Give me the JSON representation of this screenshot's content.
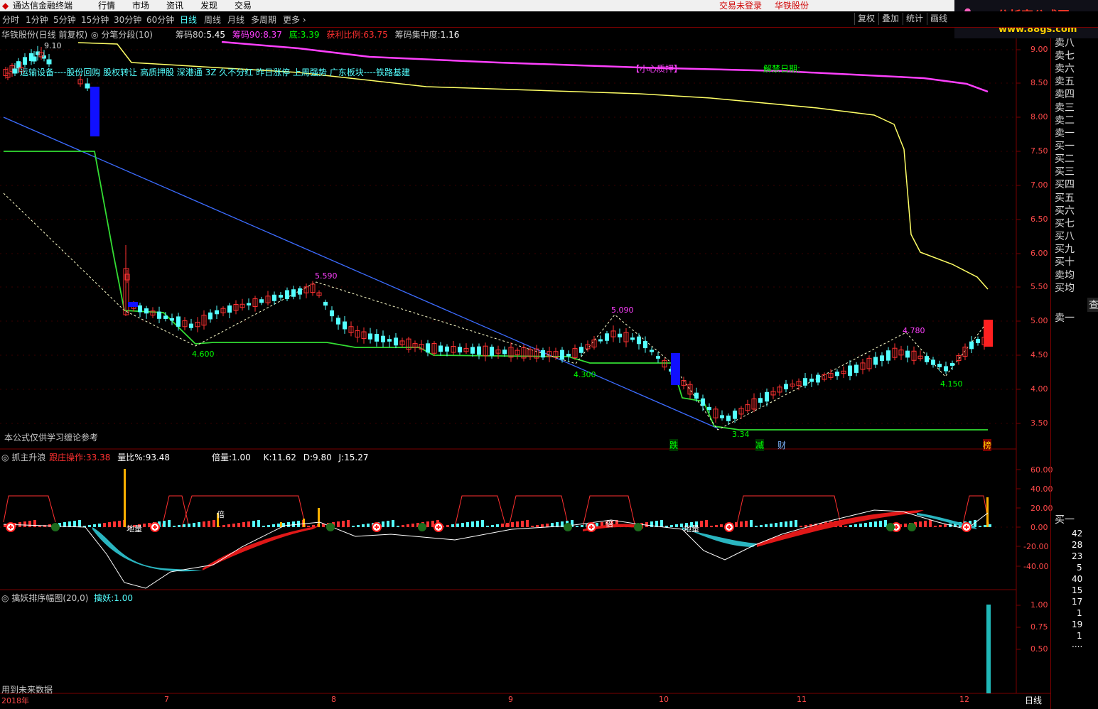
{
  "menubar": {
    "app_title": "通达信金融终端",
    "menus": [
      "行情",
      "市场",
      "资讯",
      "发现",
      "交易"
    ],
    "login_status": "交易未登录",
    "stock_name": "华铁股份",
    "logo_text": "分析家公式网",
    "logo_url": "www.88gs.com"
  },
  "tabs": [
    "分时",
    "1分钟",
    "5分钟",
    "15分钟",
    "30分钟",
    "60分钟",
    "日线",
    "周线",
    "月线",
    "多周期",
    "更多 ›"
  ],
  "active_tab": "日线",
  "right_buttons": [
    "复权",
    "叠加",
    "统计",
    "画线"
  ],
  "main_panel": {
    "title": "华铁股份(日线 前复权)",
    "indicator": "分笔分段(10)",
    "stats": [
      {
        "label": "筹码80:",
        "value": "5.45",
        "color": "#ffffff"
      },
      {
        "label": "筹码90:",
        "value": "8.37",
        "color": "#ff40ff"
      },
      {
        "label": "底:",
        "value": "3.39",
        "color": "#00ff00"
      },
      {
        "label": "获利比例:",
        "value": "63.75",
        "color": "#ff3030"
      },
      {
        "label": "筹码集中度:",
        "value": "1.16",
        "color": "#ffffff"
      }
    ],
    "concepts_line": "运输设备----股份回购 股权转让 高质押股 深港通 3Z 久不分红 昨日涨停 上周强势 广东板块----铁路基建",
    "pledge_note": "【小心质押】",
    "unlock_note": "解禁日期:",
    "footnote": "本公式仅供学习缠论参考",
    "price_labels": [
      "9.10",
      "5.590",
      "4.600",
      "5.090",
      "4.300",
      "3.34",
      "4.780",
      "4.150"
    ],
    "signal_labels": [
      "跌",
      "减",
      "财",
      "榜"
    ],
    "price_axis": [
      "9.00",
      "8.50",
      "8.00",
      "7.50",
      "7.00",
      "6.50",
      "6.00",
      "5.50",
      "5.00",
      "4.50",
      "4.00",
      "3.50"
    ]
  },
  "panel2": {
    "title": "抓主升浪",
    "stats": [
      {
        "label": "跟庄操作:",
        "value": "33.38",
        "color": "#ff3030"
      },
      {
        "label": "量比%:",
        "value": "93.48",
        "color": "#ffffff"
      },
      {
        "label": "倍量:",
        "value": "1.00",
        "color": "#ffffff"
      },
      {
        "label": "K:",
        "value": "11.62",
        "color": "#ffffff"
      },
      {
        "label": "D:",
        "value": "9.80",
        "color": "#ffffff"
      },
      {
        "label": "J:",
        "value": "15.27",
        "color": "#ffffff"
      }
    ],
    "axis": [
      "60.00",
      "40.00",
      "20.00",
      "0.00",
      "-20.00",
      "-40.00"
    ],
    "markers": [
      "倍",
      "地量",
      "压"
    ]
  },
  "panel3": {
    "title": "擒妖排序幅图(20,0)",
    "stat_label": "擒妖:",
    "stat_value": "1.00",
    "axis": [
      "1.00",
      "0.75",
      "0.50"
    ],
    "footnote": "用到未来数据"
  },
  "time_axis": {
    "year": "2018年",
    "months": [
      "7",
      "8",
      "9",
      "10",
      "11",
      "12"
    ],
    "period": "日线"
  },
  "order_book": {
    "sell_levels": [
      "卖八",
      "卖七",
      "卖六",
      "卖五",
      "卖四",
      "卖三",
      "卖二",
      "卖一"
    ],
    "buy_levels": [
      "买一",
      "买二",
      "买三",
      "买四",
      "买五",
      "买六",
      "买七",
      "买八",
      "买九",
      "买十"
    ],
    "avg_levels": [
      "卖均",
      "买均"
    ],
    "query_btn": "查",
    "sell1_label": "卖一",
    "buy1_label": "买一",
    "volumes": [
      "42",
      "28",
      "23",
      "5",
      "40",
      "15",
      "17",
      "1",
      "19",
      "1",
      "...."
    ]
  },
  "colors": {
    "up": "#ff3232",
    "down": "#54ffff",
    "axis": "#ff4a4a",
    "frame": "#7a0000"
  }
}
